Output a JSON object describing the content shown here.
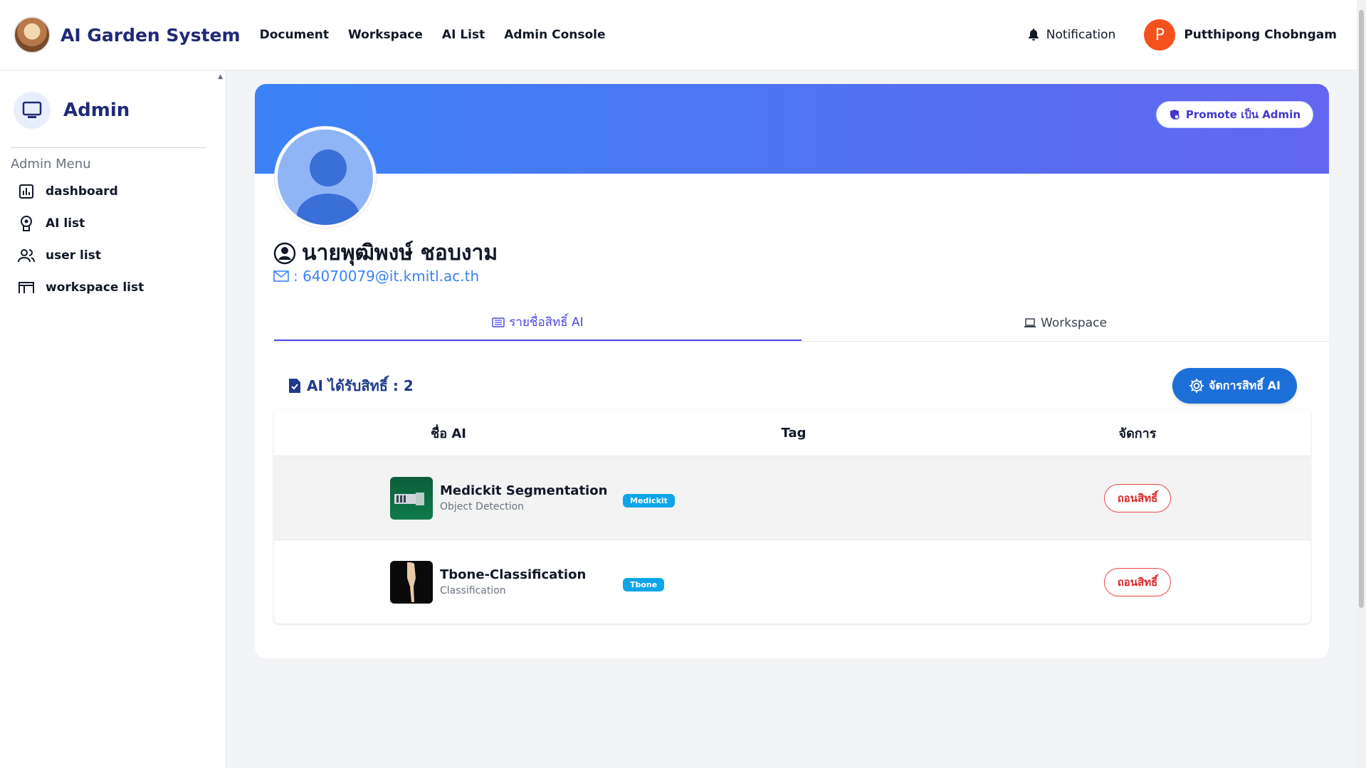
{
  "navbar": {
    "brand": "AI Garden System",
    "links": [
      "Document",
      "Workspace",
      "AI List",
      "Admin Console"
    ],
    "notification_label": "Notification",
    "user_initial": "P",
    "user_name": "Putthipong Chobngam"
  },
  "sidebar": {
    "title": "Admin",
    "menu_label": "Admin Menu",
    "items": [
      {
        "label": "dashboard",
        "icon": "chart-icon"
      },
      {
        "label": "AI list",
        "icon": "brain-icon"
      },
      {
        "label": "user list",
        "icon": "users-icon"
      },
      {
        "label": "workspace list",
        "icon": "workspace-icon"
      }
    ]
  },
  "profile": {
    "promote_label": "Promote เป็น Admin",
    "name": "นายพุฒิพงษ์ ชอบงาม",
    "email": ": 64070079@it.kmitl.ac.th",
    "tabs": [
      {
        "label": "รายชื่อสิทธิ์ AI",
        "active": true
      },
      {
        "label": "Workspace",
        "active": false
      }
    ],
    "section_title": "AI ได้รับสิทธิ์ : 2",
    "manage_label": "จัดการสิทธิ์ AI"
  },
  "table": {
    "headers": [
      "ชื่อ AI",
      "Tag",
      "จัดการ"
    ],
    "rows": [
      {
        "name": "Medickit Segmentation",
        "type": "Object Detection",
        "tag": "Medickit",
        "action": "ถอนสิทธิ์"
      },
      {
        "name": "Tbone-Classification",
        "type": "Classification",
        "tag": "Tbone",
        "action": "ถอนสิทธิ์"
      }
    ]
  },
  "colors": {
    "brand": "#1e2a78",
    "banner_start": "#3b82f6",
    "banner_end": "#6366f1",
    "accent": "#4f46e5",
    "primary_button": "#1d6fd8",
    "tag": "#0ea5e9",
    "danger": "#dc2626",
    "avatar": "#f4511e"
  }
}
